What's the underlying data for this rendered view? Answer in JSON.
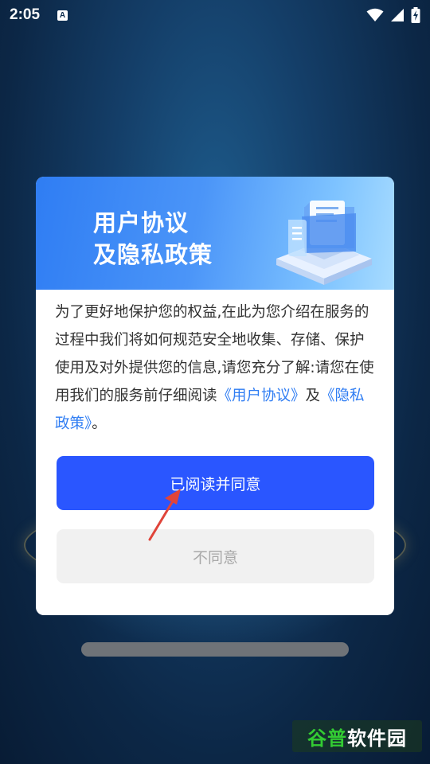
{
  "status_bar": {
    "time": "2:05",
    "notification_icon": "A"
  },
  "dialog": {
    "banner_title_line1": "用户协议",
    "banner_title_line2": "及隐私政策",
    "body_intro": "为了更好地保护您的权益,在此为您介绍在服务的过程中我们将如何规范安全地收集、存储、保护使用及对外提供您的信息,请您充分了解:请您在使用我们的服务前仔细阅读",
    "link_user_agreement": "《用户协议》",
    "conjunction": "及",
    "link_privacy_policy": "《隐私政策》",
    "body_end": "。",
    "agree_button": "已阅读并同意",
    "disagree_button": "不同意"
  },
  "watermark": {
    "part1": "谷普",
    "part2": "软件园"
  },
  "colors": {
    "primary_button": "#2a56ff",
    "link": "#2f7df3",
    "banner_start": "#2f7df3",
    "banner_end": "#a8dcff",
    "annotation_arrow": "#e0443a"
  }
}
